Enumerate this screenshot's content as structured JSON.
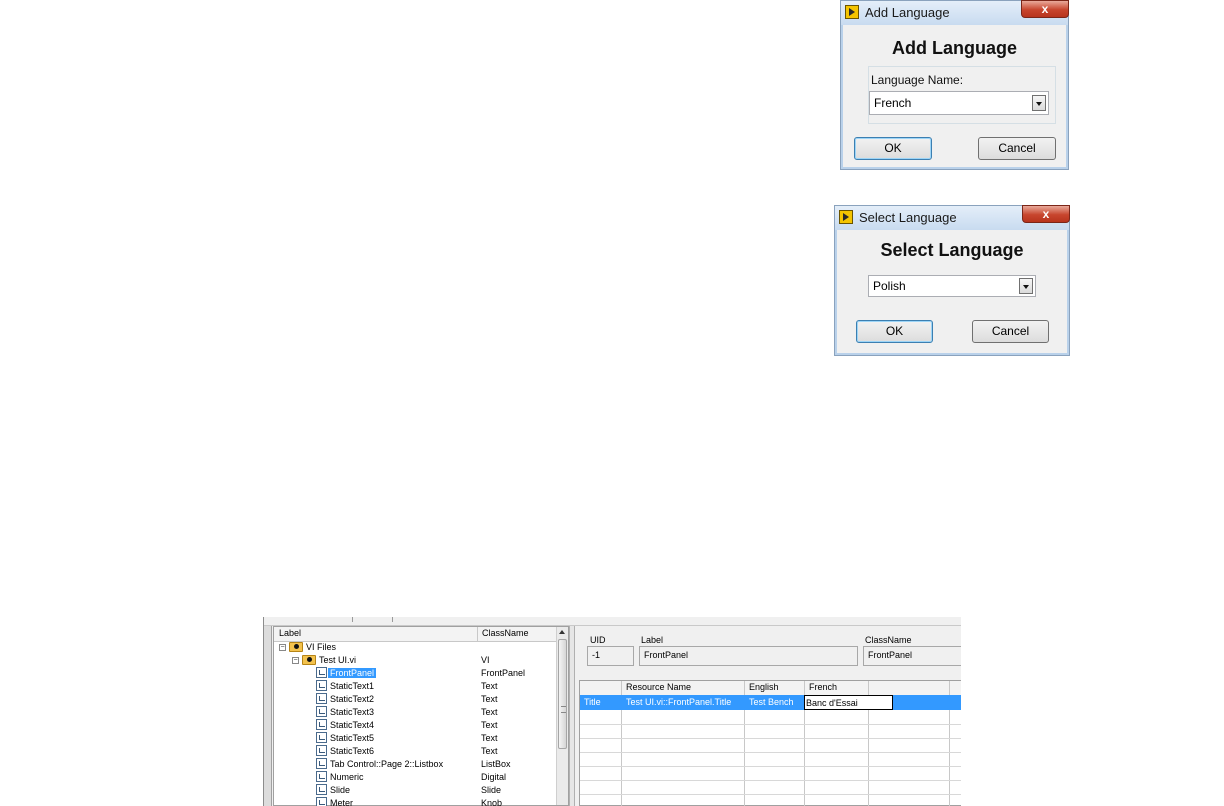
{
  "add_language_dialog": {
    "title": "Add Language",
    "heading": "Add Language",
    "field_label": "Language Name:",
    "selected_value": "French",
    "ok_label": "OK",
    "cancel_label": "Cancel"
  },
  "select_language_dialog": {
    "title": "Select Language",
    "heading": "Select Language",
    "selected_value": "Polish",
    "ok_label": "OK",
    "cancel_label": "Cancel"
  },
  "close_glyph": "x",
  "editor": {
    "tree": {
      "columns": {
        "label": "Label",
        "classname": "ClassName"
      },
      "rows": [
        {
          "label": "VI Files",
          "classname": "",
          "icon": "folder-icon"
        },
        {
          "label": "Test UI.vi",
          "classname": "VI",
          "icon": "vi-folder-icon"
        },
        {
          "label": "FrontPanel",
          "classname": "FrontPanel",
          "icon": "control-icon",
          "selected": true
        },
        {
          "label": "StaticText1",
          "classname": "Text",
          "icon": "control-icon"
        },
        {
          "label": "StaticText2",
          "classname": "Text",
          "icon": "control-icon"
        },
        {
          "label": "StaticText3",
          "classname": "Text",
          "icon": "control-icon"
        },
        {
          "label": "StaticText4",
          "classname": "Text",
          "icon": "control-icon"
        },
        {
          "label": "StaticText5",
          "classname": "Text",
          "icon": "control-icon"
        },
        {
          "label": "StaticText6",
          "classname": "Text",
          "icon": "control-icon"
        },
        {
          "label": "Tab Control::Page 2::Listbox",
          "classname": "ListBox",
          "icon": "control-icon"
        },
        {
          "label": "Numeric",
          "classname": "Digital",
          "icon": "control-icon"
        },
        {
          "label": "Slide",
          "classname": "Slide",
          "icon": "control-icon"
        },
        {
          "label": "Meter",
          "classname": "Knob",
          "icon": "control-icon"
        }
      ]
    },
    "properties": {
      "uid_label": "UID",
      "uid_value": "-1",
      "label_label": "Label",
      "label_value": "FrontPanel",
      "classname_label": "ClassName",
      "classname_value": "FrontPanel"
    },
    "grid": {
      "headers": [
        "",
        "Resource Name",
        "English",
        "French",
        ""
      ],
      "selected_row": {
        "type": "Title",
        "resource_name": "Test UI.vi::FrontPanel.Title",
        "english": "Test Bench",
        "french": "Banc d'Essai"
      }
    }
  }
}
